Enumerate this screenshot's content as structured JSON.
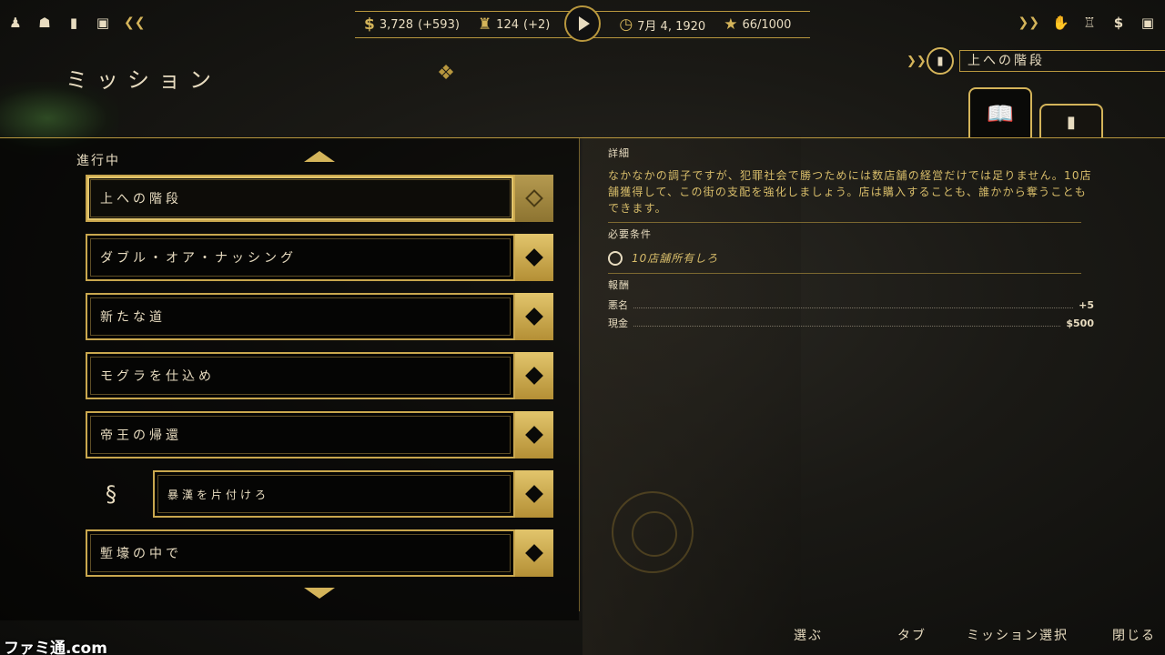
{
  "topbar": {
    "money": "3,728",
    "money_delta": "(+593)",
    "beer": "124",
    "beer_delta": "(+2)",
    "date": "7月 4, 1920",
    "heat": "66/1000",
    "money_symbol": "$",
    "right_money_symbol": "$"
  },
  "page_title": "ミッション",
  "current_mission": {
    "label": "上への階段"
  },
  "section_label": "進行中",
  "missions": [
    {
      "label": "上への階段"
    },
    {
      "label": "ダブル・オア・ナッシング"
    },
    {
      "label": "新たな道"
    },
    {
      "label": "モグラを仕込め"
    },
    {
      "label": "帝王の帰還"
    },
    {
      "label": "暴漢を片付けろ"
    },
    {
      "label": "塹壕の中で"
    }
  ],
  "details": {
    "heading": "詳細",
    "description": "なかなかの調子ですが、犯罪社会で勝つためには数店舗の経営だけでは足りません。10店舗獲得して、この街の支配を強化しましょう。店は購入することも、誰かから奪うこともできます。",
    "requirements_heading": "必要条件",
    "requirement": "10店舗所有しろ",
    "rewards_heading": "報酬",
    "rewards": [
      {
        "key": "悪名",
        "value": "+5"
      },
      {
        "key": "現金",
        "value": "$500"
      }
    ]
  },
  "hints": {
    "select": "選ぶ",
    "tab": "タブ",
    "mission_select": "ミッション選択",
    "close": "閉じる"
  },
  "watermark": "ファミ通.com",
  "colors": {
    "accent_gold": "#d4b45a",
    "text_cream": "#e8dcc0",
    "background": "#0c0c0a"
  }
}
